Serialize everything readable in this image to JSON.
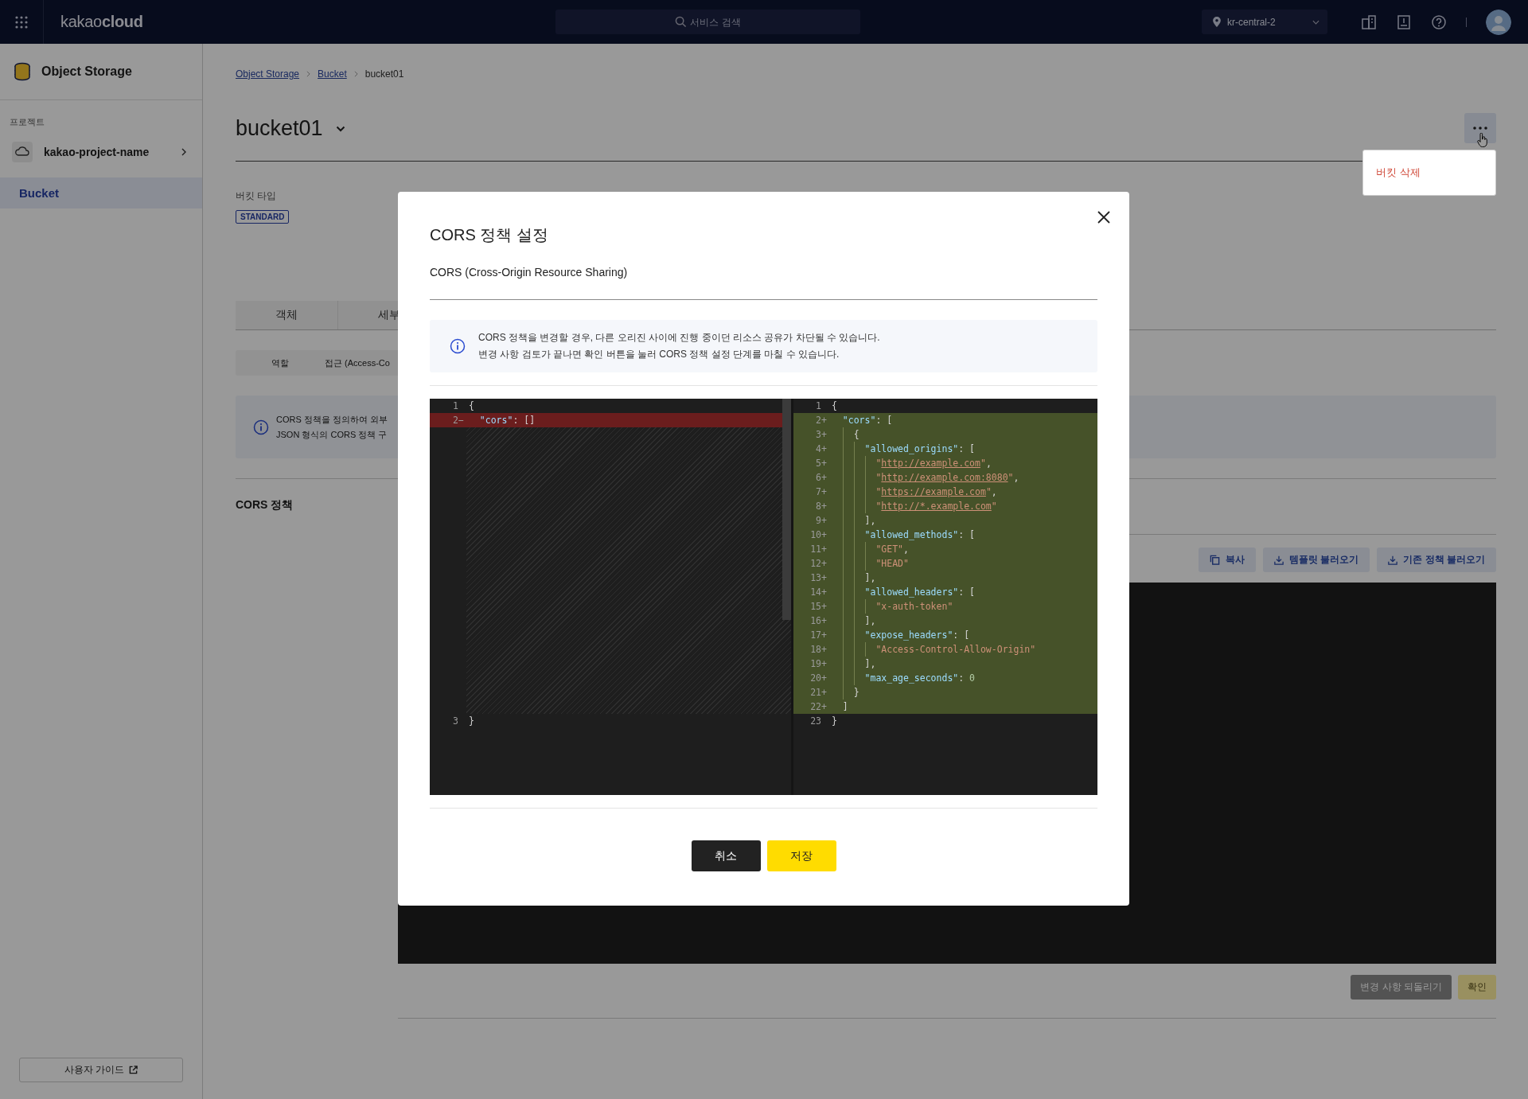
{
  "topbar": {
    "logo": "kakao**cloud**",
    "search": {
      "placeholder": "서비스 검색"
    },
    "region": "kr-central-2"
  },
  "sidebar": {
    "service": "Object Storage",
    "project_label": "프로젝트",
    "project": "kakao-project-name",
    "items": [
      {
        "label": "Bucket",
        "selected": true
      }
    ],
    "guide_button": "사용자 가이드"
  },
  "breadcrumb": [
    "Object Storage",
    "Bucket",
    "bucket01"
  ],
  "title": "bucket01",
  "menu": {
    "expanded": true,
    "items": [
      {
        "label": "버킷 삭제",
        "kind": "danger"
      }
    ]
  },
  "bucket_type": {
    "label": "버킷 타입",
    "value": "STANDARD"
  },
  "tabs": [
    {
      "label": "객체",
      "selected": false
    },
    {
      "label": "세부",
      "selected": false
    }
  ],
  "role_table": {
    "columns": [
      "역할",
      "접근 (Access-Co"
    ]
  },
  "notice": {
    "lines": [
      "CORS 정책을 정의하여 외부",
      "JSON 형식의 CORS 정책 구"
    ]
  },
  "cors_section": {
    "title": "CORS 정책",
    "toolbar": [
      {
        "label": "복사",
        "kind": "copy"
      },
      {
        "label": "템플릿 불러오기",
        "kind": "download"
      },
      {
        "label": "기존 정책 불러오기",
        "kind": "download"
      }
    ],
    "actions": [
      {
        "label": "변경 사항 되돌리기",
        "kind": "secondary",
        "disabled": true
      },
      {
        "label": "확인",
        "kind": "primary",
        "disabled": true
      }
    ]
  },
  "modal": {
    "title": "CORS 정책 설정",
    "subtitle": "CORS (Cross-Origin Resource Sharing)",
    "notice": [
      "CORS 정책을 변경할 경우, 다른 오리진 사이에 진행 중이던 리소스 공유가 차단될 수 있습니다.",
      "변경 사항 검토가 끝나면 확인 버튼을 눌러 CORS 정책 설정 단계를 마칠 수 있습니다."
    ],
    "diff": {
      "left": [
        {
          "num": "1",
          "kind": "context",
          "tokens": [
            {
              "kind": "punc",
              "s": "{"
            }
          ]
        },
        {
          "num": "2",
          "marker": "−",
          "kind": "removed",
          "tokens": [
            {
              "kind": "key",
              "s": "  \"cors\""
            },
            {
              "kind": "punc",
              "s": ": []"
            }
          ]
        },
        {
          "kind": "spacer"
        },
        {
          "num": "3",
          "kind": "context",
          "tokens": [
            {
              "kind": "punc",
              "s": "}"
            }
          ]
        }
      ],
      "right": [
        {
          "num": "1",
          "kind": "context",
          "tokens": [
            {
              "kind": "punc",
              "s": "{"
            }
          ]
        },
        {
          "num": "2",
          "marker": "+",
          "kind": "added",
          "tokens": [
            {
              "kind": "key",
              "s": "  \"cors\""
            },
            {
              "kind": "punc",
              "s": ": ["
            }
          ]
        },
        {
          "num": "3",
          "marker": "+",
          "kind": "added",
          "tokens": [
            {
              "kind": "punc",
              "s": "    {"
            }
          ]
        },
        {
          "num": "4",
          "marker": "+",
          "kind": "added",
          "tokens": [
            {
              "kind": "key",
              "s": "      \"allowed_origins\""
            },
            {
              "kind": "punc",
              "s": ": ["
            }
          ]
        },
        {
          "num": "5",
          "marker": "+",
          "kind": "added",
          "tokens": [
            {
              "kind": "str",
              "s": "        \""
            },
            {
              "kind": "link",
              "s": "http://example.com"
            },
            {
              "kind": "str",
              "s": "\""
            },
            {
              "kind": "punc",
              "s": ","
            }
          ]
        },
        {
          "num": "6",
          "marker": "+",
          "kind": "added",
          "tokens": [
            {
              "kind": "str",
              "s": "        \""
            },
            {
              "kind": "link",
              "s": "http://example.com:8080"
            },
            {
              "kind": "str",
              "s": "\""
            },
            {
              "kind": "punc",
              "s": ","
            }
          ]
        },
        {
          "num": "7",
          "marker": "+",
          "kind": "added",
          "tokens": [
            {
              "kind": "str",
              "s": "        \""
            },
            {
              "kind": "link",
              "s": "https://example.com"
            },
            {
              "kind": "str",
              "s": "\""
            },
            {
              "kind": "punc",
              "s": ","
            }
          ]
        },
        {
          "num": "8",
          "marker": "+",
          "kind": "added",
          "tokens": [
            {
              "kind": "str",
              "s": "        \""
            },
            {
              "kind": "link",
              "s": "http://*.example.com"
            },
            {
              "kind": "str",
              "s": "\""
            }
          ]
        },
        {
          "num": "9",
          "marker": "+",
          "kind": "added",
          "tokens": [
            {
              "kind": "punc",
              "s": "      ],"
            }
          ]
        },
        {
          "num": "10",
          "marker": "+",
          "kind": "added",
          "tokens": [
            {
              "kind": "key",
              "s": "      \"allowed_methods\""
            },
            {
              "kind": "punc",
              "s": ": ["
            }
          ]
        },
        {
          "num": "11",
          "marker": "+",
          "kind": "added",
          "tokens": [
            {
              "kind": "str",
              "s": "        \"GET\""
            },
            {
              "kind": "punc",
              "s": ","
            }
          ]
        },
        {
          "num": "12",
          "marker": "+",
          "kind": "added",
          "tokens": [
            {
              "kind": "str",
              "s": "        \"HEAD\""
            }
          ]
        },
        {
          "num": "13",
          "marker": "+",
          "kind": "added",
          "tokens": [
            {
              "kind": "punc",
              "s": "      ],"
            }
          ]
        },
        {
          "num": "14",
          "marker": "+",
          "kind": "added",
          "tokens": [
            {
              "kind": "key",
              "s": "      \"allowed_headers\""
            },
            {
              "kind": "punc",
              "s": ": ["
            }
          ]
        },
        {
          "num": "15",
          "marker": "+",
          "kind": "added",
          "tokens": [
            {
              "kind": "str",
              "s": "        \"x-auth-token\""
            }
          ]
        },
        {
          "num": "16",
          "marker": "+",
          "kind": "added",
          "tokens": [
            {
              "kind": "punc",
              "s": "      ],"
            }
          ]
        },
        {
          "num": "17",
          "marker": "+",
          "kind": "added",
          "tokens": [
            {
              "kind": "key",
              "s": "      \"expose_headers\""
            },
            {
              "kind": "punc",
              "s": ": ["
            }
          ]
        },
        {
          "num": "18",
          "marker": "+",
          "kind": "added",
          "tokens": [
            {
              "kind": "str",
              "s": "        \"Access-Control-Allow-Origin\""
            }
          ]
        },
        {
          "num": "19",
          "marker": "+",
          "kind": "added",
          "tokens": [
            {
              "kind": "punc",
              "s": "      ],"
            }
          ]
        },
        {
          "num": "20",
          "marker": "+",
          "kind": "added",
          "tokens": [
            {
              "kind": "key",
              "s": "      \"max_age_seconds\""
            },
            {
              "kind": "punc",
              "s": ": "
            },
            {
              "kind": "num",
              "s": "0"
            }
          ]
        },
        {
          "num": "21",
          "marker": "+",
          "kind": "added",
          "tokens": [
            {
              "kind": "punc",
              "s": "    }"
            }
          ]
        },
        {
          "num": "22",
          "marker": "+",
          "kind": "added",
          "tokens": [
            {
              "kind": "punc",
              "s": "  ]"
            }
          ]
        },
        {
          "num": "23",
          "kind": "context",
          "tokens": [
            {
              "kind": "punc",
              "s": "}"
            }
          ]
        }
      ]
    },
    "buttons": [
      {
        "label": "취소",
        "kind": "secondary"
      },
      {
        "label": "저장",
        "kind": "primary"
      }
    ]
  }
}
